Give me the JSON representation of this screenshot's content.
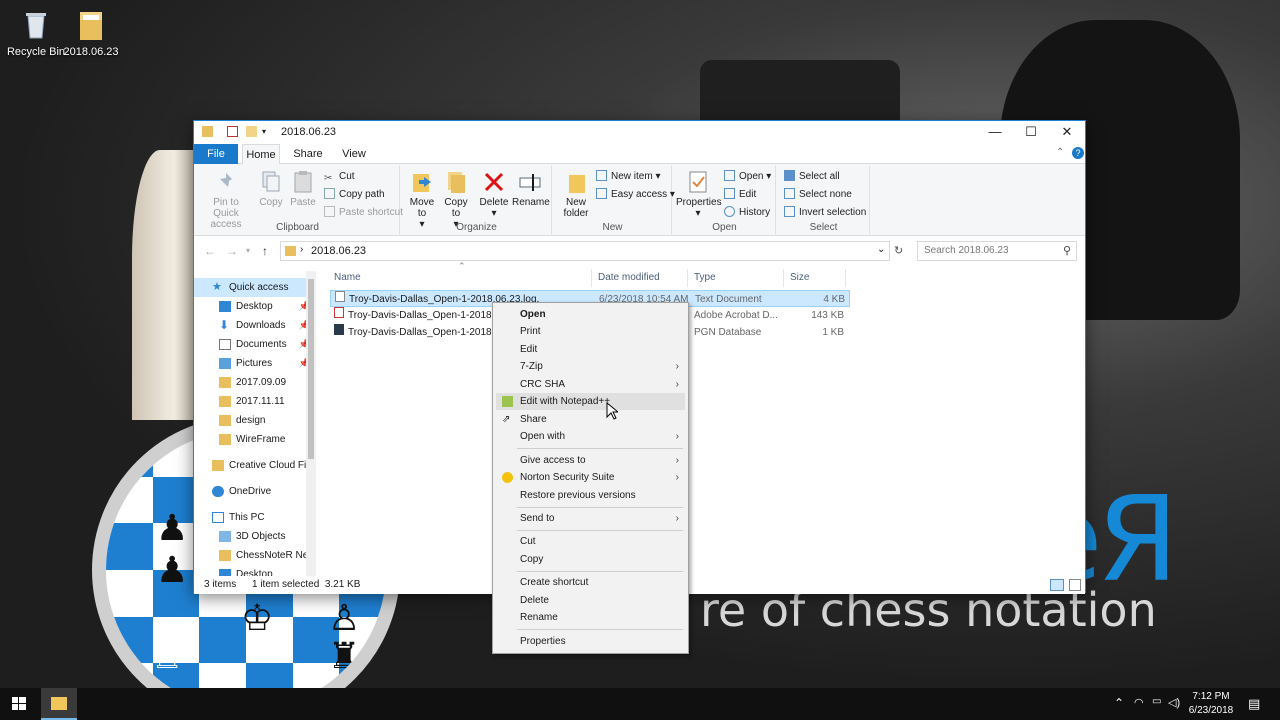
{
  "desktop": {
    "icons": [
      {
        "label": "Recycle Bin"
      },
      {
        "label": "2018.06.23"
      }
    ],
    "brand_text": "eЯ",
    "tagline": "re of chess notation"
  },
  "window": {
    "title": "2018.06.23",
    "tabs": {
      "file": "File",
      "home": "Home",
      "share": "Share",
      "view": "View"
    },
    "ribbon": {
      "clipboard": {
        "label": "Clipboard",
        "pin": "Pin to Quick access",
        "copy": "Copy",
        "paste": "Paste",
        "cut": "Cut",
        "copy_path": "Copy path",
        "paste_shortcut": "Paste shortcut"
      },
      "organize": {
        "label": "Organize",
        "move_to": "Move to",
        "copy_to": "Copy to",
        "delete": "Delete",
        "rename": "Rename"
      },
      "new": {
        "label": "New",
        "new_folder": "New folder",
        "new_item": "New item",
        "easy_access": "Easy access"
      },
      "open": {
        "label": "Open",
        "properties": "Properties",
        "open": "Open",
        "edit": "Edit",
        "history": "History"
      },
      "select": {
        "label": "Select",
        "select_all": "Select all",
        "select_none": "Select none",
        "invert": "Invert selection"
      }
    },
    "address": {
      "path": "2018.06.23",
      "search_placeholder": "Search 2018.06.23"
    },
    "nav": [
      {
        "label": "Quick access",
        "pinned": false
      },
      {
        "label": "Desktop",
        "pinned": true
      },
      {
        "label": "Downloads",
        "pinned": true
      },
      {
        "label": "Documents",
        "pinned": true
      },
      {
        "label": "Pictures",
        "pinned": true
      },
      {
        "label": "2017.09.09",
        "pinned": false
      },
      {
        "label": "2017.11.11",
        "pinned": false
      },
      {
        "label": "design",
        "pinned": false
      },
      {
        "label": "WireFrame",
        "pinned": false
      },
      {
        "label": "Creative Cloud Fil",
        "pinned": false
      },
      {
        "label": "OneDrive",
        "pinned": false
      },
      {
        "label": "This PC",
        "pinned": false
      },
      {
        "label": "3D Objects",
        "pinned": false
      },
      {
        "label": "ChessNoteR Nex",
        "pinned": false
      },
      {
        "label": "Desktop",
        "pinned": false
      }
    ],
    "columns": {
      "name": "Name",
      "date": "Date modified",
      "type": "Type",
      "size": "Size"
    },
    "files": [
      {
        "name": "Troy-Davis-Dallas_Open-1-2018.06.23.log.txt",
        "date": "6/23/2018 10:54 AM",
        "type": "Text Document",
        "size": "4 KB",
        "selected": true
      },
      {
        "name": "Troy-Davis-Dallas_Open-1-2018.0",
        "date": "",
        "type": "Adobe Acrobat D...",
        "size": "143 KB",
        "selected": false
      },
      {
        "name": "Troy-Davis-Dallas_Open-1-2018.0",
        "date": "",
        "type": "PGN Database",
        "size": "1 KB",
        "selected": false
      }
    ],
    "status": {
      "items": "3 items",
      "selected": "1 item selected  3.21 KB"
    }
  },
  "context_menu": [
    {
      "label": "Open",
      "bold": true
    },
    {
      "label": "Print"
    },
    {
      "label": "Edit"
    },
    {
      "label": "7-Zip",
      "submenu": true
    },
    {
      "label": "CRC SHA",
      "submenu": true
    },
    {
      "label": "Edit with Notepad++",
      "hover": true
    },
    {
      "label": "Share"
    },
    {
      "label": "Open with",
      "submenu": true
    },
    {
      "label": "Give access to",
      "submenu": true
    },
    {
      "label": "Norton Security Suite",
      "submenu": true
    },
    {
      "label": "Restore previous versions"
    },
    {
      "label": "Send to",
      "submenu": true
    },
    {
      "label": "Cut"
    },
    {
      "label": "Copy"
    },
    {
      "label": "Create shortcut"
    },
    {
      "label": "Delete"
    },
    {
      "label": "Rename"
    },
    {
      "label": "Properties"
    }
  ],
  "taskbar": {
    "time": "7:12 PM",
    "date": "6/23/2018"
  },
  "colors": {
    "accent": "#1979ca",
    "selection": "#cce8ff",
    "brand": "#1689d6"
  }
}
